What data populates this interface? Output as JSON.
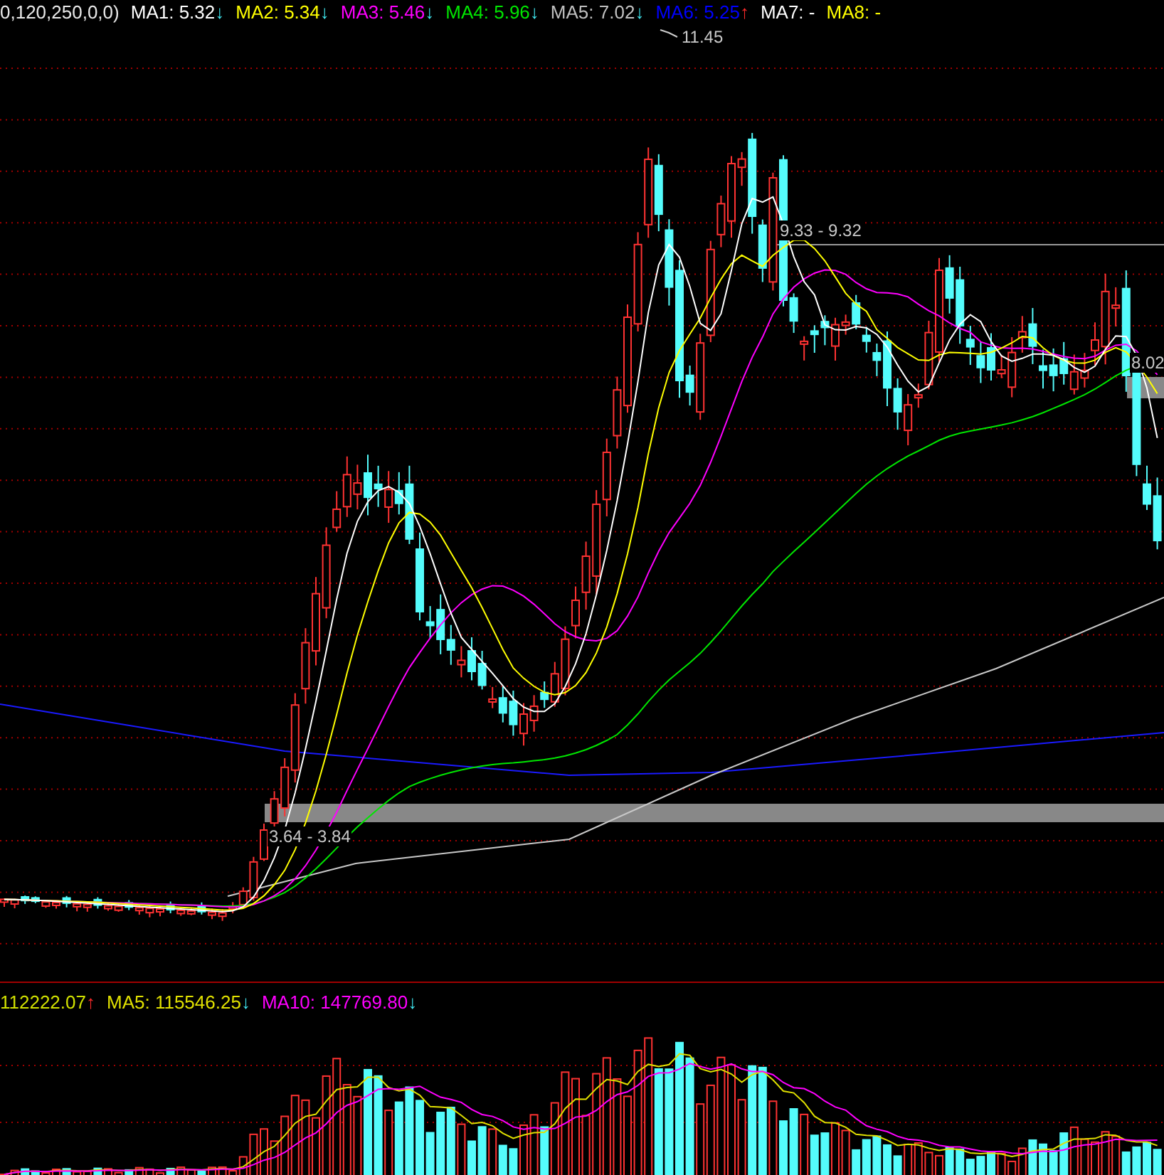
{
  "legend": {
    "prefix": "0,120,250,0,0)",
    "items": [
      {
        "label": "MA1: 5.32",
        "color": "#ffffff",
        "arrow": {
          "text": "↓",
          "color": "#40e8f0"
        }
      },
      {
        "label": "MA2: 5.34",
        "color": "#ffff00",
        "arrow": {
          "text": "↓",
          "color": "#40e8f0"
        }
      },
      {
        "label": "MA3: 5.46",
        "color": "#ff00ff",
        "arrow": {
          "text": "↓",
          "color": "#40e8f0"
        }
      },
      {
        "label": "MA4: 5.96",
        "color": "#00e600",
        "arrow": {
          "text": "↓",
          "color": "#40e8f0"
        }
      },
      {
        "label": "MA5: 7.02",
        "color": "#c0c0c0",
        "arrow": {
          "text": "↓",
          "color": "#40e8f0"
        }
      },
      {
        "label": "MA6: 5.25",
        "color": "#0000ff",
        "arrow": {
          "text": "↑",
          "color": "#ff2a2a"
        }
      },
      {
        "label": "MA7: -",
        "color": "#ffffff"
      },
      {
        "label": "MA8: -",
        "color": "#ffff00"
      }
    ]
  },
  "annotations": {
    "peak": "11.45",
    "upper_range": "9.33 - 9.32",
    "right_marker": "8.02",
    "lower_range": "3.64 - 3.84"
  },
  "volume_legend": {
    "items": [
      {
        "label": "112222.07",
        "color": "#d0e000",
        "arrow": {
          "text": "↑",
          "color": "#ff2a2a"
        }
      },
      {
        "label": "MA5: 115546.25",
        "color": "#e0e000",
        "arrow": {
          "text": "↓",
          "color": "#40e8f0"
        }
      },
      {
        "label": "MA10: 147769.80",
        "color": "#ff00ff",
        "arrow": {
          "text": "↓",
          "color": "#40e8f0"
        }
      }
    ]
  }
}
